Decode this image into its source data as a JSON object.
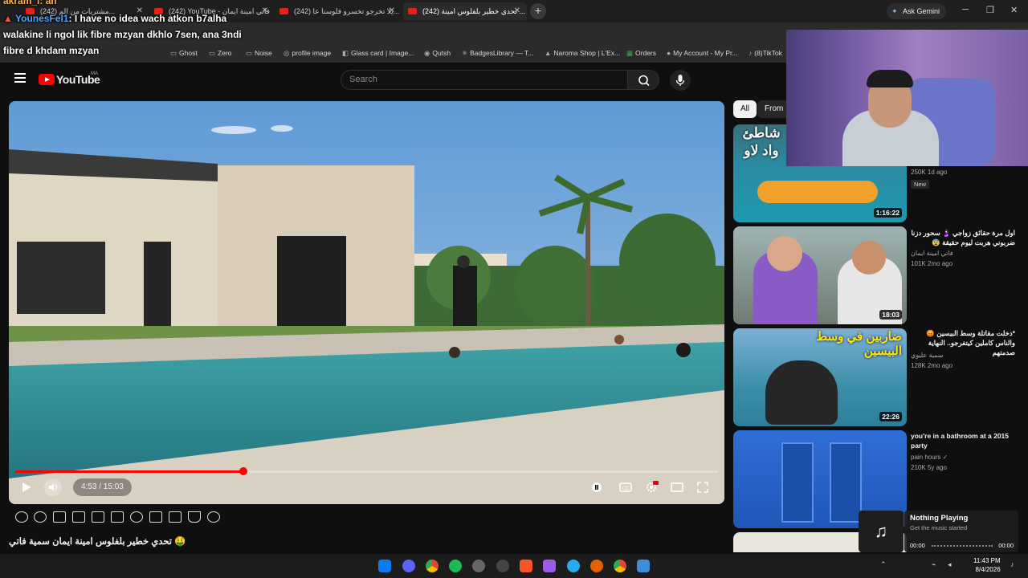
{
  "browser": {
    "tabs": [
      {
        "label": "(242) مشتريات من الم..."
      },
      {
        "label": "(242) YouTube - فاتي امينة ايمان"
      },
      {
        "label": "(242) يلا تخرجو تخسرو فلوسنا عا..."
      },
      {
        "label": "(242) تحدي خطير بلفلوس امينة ..."
      }
    ],
    "ask_gemini": "Ask Gemini",
    "bookmarks": [
      "Ghost",
      "Zero",
      "Noise",
      "profile image",
      "Glass card | Image...",
      "Qutsh",
      "BadgesLibrary — T...",
      "Naroma Shop | L'Ex...",
      "Orders",
      "My Account - My Pr...",
      "(8)TikTok"
    ]
  },
  "chat": [
    {
      "user": "akram_i",
      "text": ": ah"
    },
    {
      "user": "YounesFel1",
      "text": ": I have no idea wach atkon b7alha"
    },
    {
      "user": "",
      "text": "walakine li ngol lik fibre mzyan dkhlo 7sen, ana 3ndi"
    },
    {
      "user": "",
      "text": "fibre d khdam mzyan"
    }
  ],
  "youtube": {
    "logo_text": "YouTube",
    "logo_sup": "MA",
    "search_placeholder": "Search"
  },
  "player": {
    "time": "4:53 / 15:03",
    "progress": 0.325
  },
  "video_title": "تحدي خطير بلفلوس امينة ايمان سمية فاتي 🤑",
  "chips": [
    "All",
    "From"
  ],
  "related": [
    {
      "title": "",
      "channel": "",
      "meta": "250K  1d ago",
      "badge": "New",
      "duration": "1:16:22",
      "thumb_text": "شاطئ واد لاو"
    },
    {
      "title": "اول مرة حقائق زواجي 🤰🏻 سحور دزنا ضربوني هربت ليوم حقيقة 😨",
      "channel": "فاتي امينة ايمان",
      "meta": "101K  2mo ago",
      "badge": "",
      "duration": "18:03",
      "thumb_text": ""
    },
    {
      "title": "*دخلت مقاتلة وسط البيسين 😡 والناس كاملين كيتفرجو.. النهاية صدمتهم",
      "channel": "سمية عليوي",
      "meta": "128K  2mo ago",
      "badge": "",
      "duration": "22:26",
      "thumb_text": "ضاربين في وسط البيسين"
    },
    {
      "title": "you're in a bathroom at a 2015 party",
      "channel": "pain hours",
      "meta": "210K  5y ago",
      "badge": "",
      "duration": "",
      "thumb_text": ""
    }
  ],
  "now_playing": {
    "title": "Nothing Playing",
    "subtitle": "Get the music started",
    "time_start": "00:00",
    "time_end": "00:00"
  },
  "taskbar": {
    "time": "11:43 PM",
    "date": "8/4/2026"
  }
}
